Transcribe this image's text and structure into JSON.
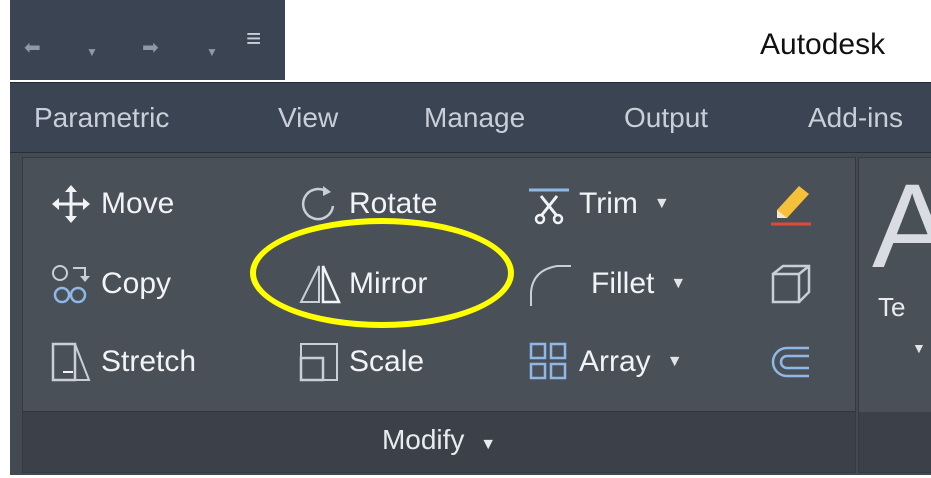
{
  "window": {
    "title": "Autodesk"
  },
  "quick_access": {
    "undo": "undo-icon",
    "redo": "redo-icon",
    "customize": "customize-icon"
  },
  "tabs": [
    {
      "label": "Parametric"
    },
    {
      "label": "View"
    },
    {
      "label": "Manage"
    },
    {
      "label": "Output"
    },
    {
      "label": "Add-ins"
    }
  ],
  "modify": {
    "panel_title": "Modify",
    "move": "Move",
    "rotate": "Rotate",
    "trim": "Trim",
    "copy": "Copy",
    "mirror": "Mirror",
    "fillet": "Fillet",
    "stretch": "Stretch",
    "scale": "Scale",
    "array": "Array"
  },
  "text_panel": {
    "letter": "A",
    "label": "Te"
  },
  "colors": {
    "ribbon": "#4a5058",
    "tab_bar": "#3b4452",
    "highlight": "#ffff00"
  }
}
